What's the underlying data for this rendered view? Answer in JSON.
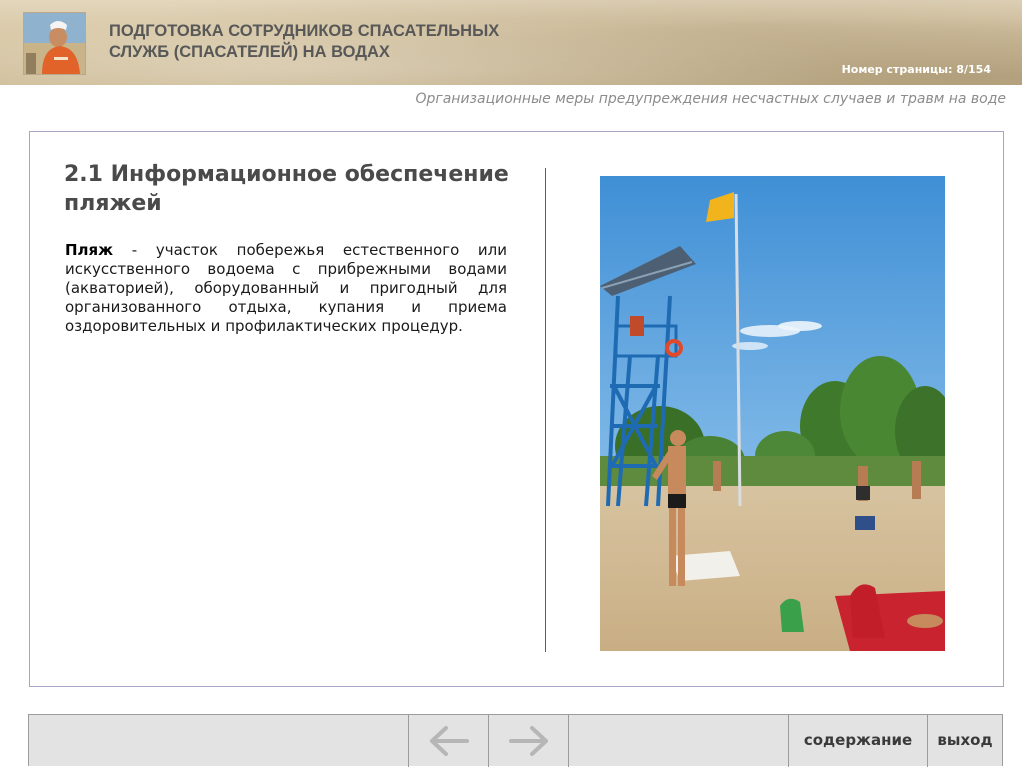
{
  "header": {
    "title_line1": "ПОДГОТОВКА СОТРУДНИКОВ СПАСАТЕЛЬНЫХ",
    "title_line2": "СЛУЖБ (СПАСАТЕЛЕЙ) НА ВОДАХ",
    "page_counter_label": "Номер страницы:",
    "page_counter_value": "8/154",
    "logo_icon": "lifeguard-photo-icon"
  },
  "section_subtitle": "Организационные меры предупреждения несчастных случаев и травм на воде",
  "lesson": {
    "title": "2.1 Информационное обеспечение пляжей",
    "term": "Пляж",
    "definition": " - участок побережья естественного или искусственного водоема  с прибрежными водами (акваторией), оборудованный и пригодный для организованного отдыха, купания и приема оздоровительных и профилактических процедур.",
    "photo_icon": "beach-lifeguard-tower-photo"
  },
  "nav": {
    "back_icon": "arrow-left-icon",
    "forward_icon": "arrow-right-icon",
    "contents_label": "содержание",
    "exit_label": "выход"
  },
  "colors": {
    "frame_border": "#a9a4c4",
    "divider": "#2c6f8e",
    "nav_background": "#e3e3e3",
    "title_text": "#4a4a4a"
  }
}
